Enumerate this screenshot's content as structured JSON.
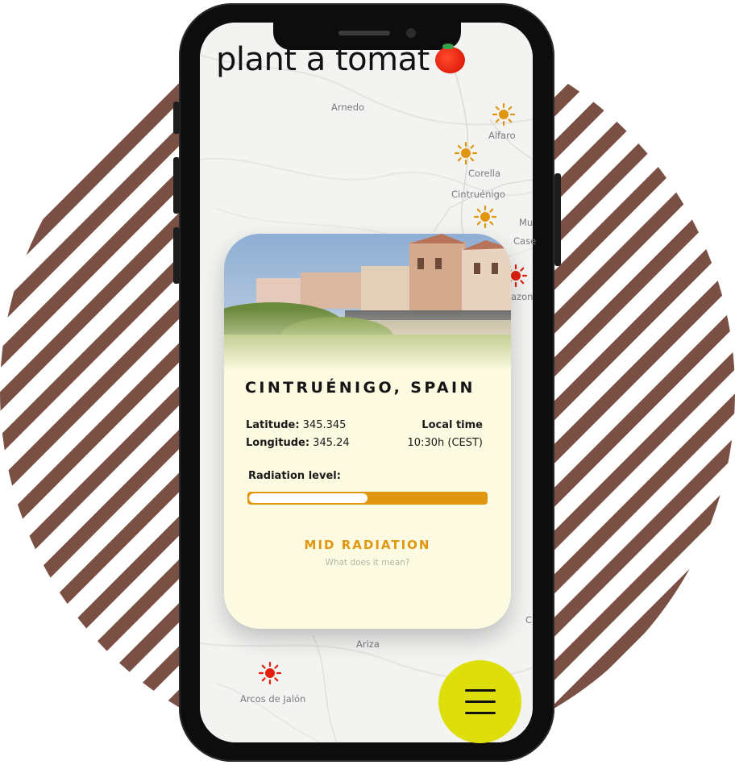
{
  "app": {
    "logo_text": "plant a tomat"
  },
  "map": {
    "labels": [
      "Arnedo",
      "Alfaro",
      "Corella",
      "Cintruénigo",
      "Mu",
      "Case",
      "azon",
      "Ariza",
      "Arcos de Jalón",
      "C"
    ],
    "radiation_markers": [
      {
        "icon": "sun-icon",
        "color": "#e0960f"
      },
      {
        "icon": "sun-icon",
        "color": "#e0960f"
      },
      {
        "icon": "sun-icon",
        "color": "#e0960f"
      },
      {
        "icon": "sun-icon",
        "color": "#e21f0f"
      },
      {
        "icon": "sun-icon",
        "color": "#e21f0f"
      }
    ]
  },
  "location": {
    "name": "CINTRUÉNIGO, SPAIN",
    "latitude_label": "Latitude:",
    "latitude_value": "345.345",
    "longitude_label": "Longitude:",
    "longitude_value": "345.24",
    "local_time_label": "Local time",
    "local_time_value": "10:30h (CEST)"
  },
  "radiation": {
    "label": "Radiation level:",
    "level_fraction": 0.5,
    "level_text": "MID RADIATION",
    "help_text": "What does it mean?"
  },
  "colors": {
    "accent": "#e0960f",
    "high_radiation": "#e21f0f",
    "menu_button": "#dede0b",
    "card_background": "#fdfae2",
    "stripe": "#7a5044"
  },
  "menu": {
    "icon": "hamburger-menu-icon"
  }
}
